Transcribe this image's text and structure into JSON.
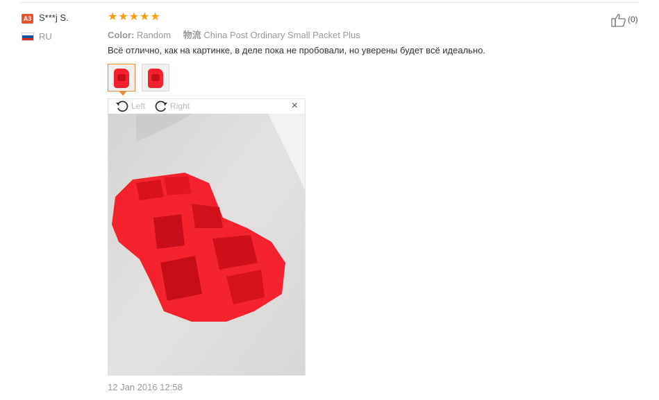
{
  "reviewer": {
    "avatar_badge": "A3",
    "name": "S***j S.",
    "country": "RU",
    "flag_colors": [
      "#ffffff",
      "#1c57a5",
      "#d52b1e"
    ]
  },
  "rating": {
    "stars": 5,
    "max": 5,
    "star_glyph": "★",
    "color": "#ff9a0c"
  },
  "attributes": [
    {
      "key": "Color:",
      "value": "Random"
    },
    {
      "key": "物流",
      "value": "China Post Ordinary Small Packet Plus"
    }
  ],
  "review": {
    "text": "Всё отлично, как на картинке, в деле пока не пробовали, но уверены будет всё идеально.",
    "date": "12 Jan 2016 12:58"
  },
  "viewer": {
    "rotate_left_label": "Left",
    "rotate_right_label": "Right",
    "close_glyph": "×"
  },
  "helpful": {
    "count": "(0)"
  },
  "colors": {
    "accent": "#e8893a",
    "star": "#ff9a0c",
    "badge": "#e8512a",
    "product_red": "#f3202e"
  }
}
